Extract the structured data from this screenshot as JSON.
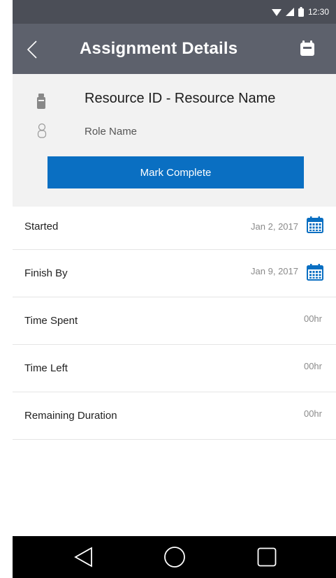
{
  "status_bar": {
    "time": "12:30"
  },
  "app_bar": {
    "title": "Assignment Details",
    "back_icon": "chevron-left-icon",
    "save_icon": "save-icon"
  },
  "assignment": {
    "resource": "Resource ID  -  Resource Name",
    "role": "Role Name",
    "mark_complete_label": "Mark Complete"
  },
  "fields": [
    {
      "label": "Started",
      "value": "Jan 2, 2017",
      "icon": "calendar-icon"
    },
    {
      "label": "Finish By",
      "value": "Jan 9, 2017",
      "icon": "calendar-icon"
    },
    {
      "label": "Time Spent",
      "value": "00hr"
    },
    {
      "label": "Time Left",
      "value": "00hr"
    },
    {
      "label": "Remaining Duration",
      "value": "00hr"
    }
  ],
  "colors": {
    "status_bar": "#4b4e57",
    "app_bar": "#5d616c",
    "accent": "#0a6fc2",
    "header_bg": "#f2f2f2"
  }
}
